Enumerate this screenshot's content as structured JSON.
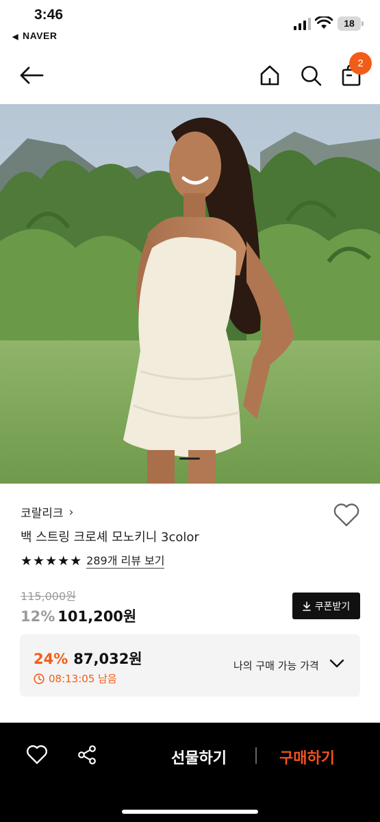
{
  "status_bar": {
    "time": "3:46",
    "back_app": "NAVER",
    "battery": "18"
  },
  "nav": {
    "cart_count": "2",
    "icons": [
      "back-arrow-icon",
      "home-icon",
      "search-icon",
      "shopping-bag-icon"
    ]
  },
  "product": {
    "brand": "코랄리크",
    "brand_chevron": "›",
    "title": "백 스트링 크로셰 모노키니 3color",
    "stars": "★★★★★",
    "review_link": "289개 리뷰 보기",
    "original_price": "115,000원",
    "discount_pct": "12%",
    "sale_price": "101,200원",
    "coupon_button": "쿠폰받기"
  },
  "my_price": {
    "discount_pct": "24%",
    "price": "87,032원",
    "timer": "08:13:05 남음",
    "label": "나의 구매 가능 가격"
  },
  "bottom_bar": {
    "gift_label": "선물하기",
    "buy_label": "구매하기"
  },
  "colors": {
    "accent": "#f25c19",
    "buy": "#f2521c",
    "dark": "#111111"
  }
}
